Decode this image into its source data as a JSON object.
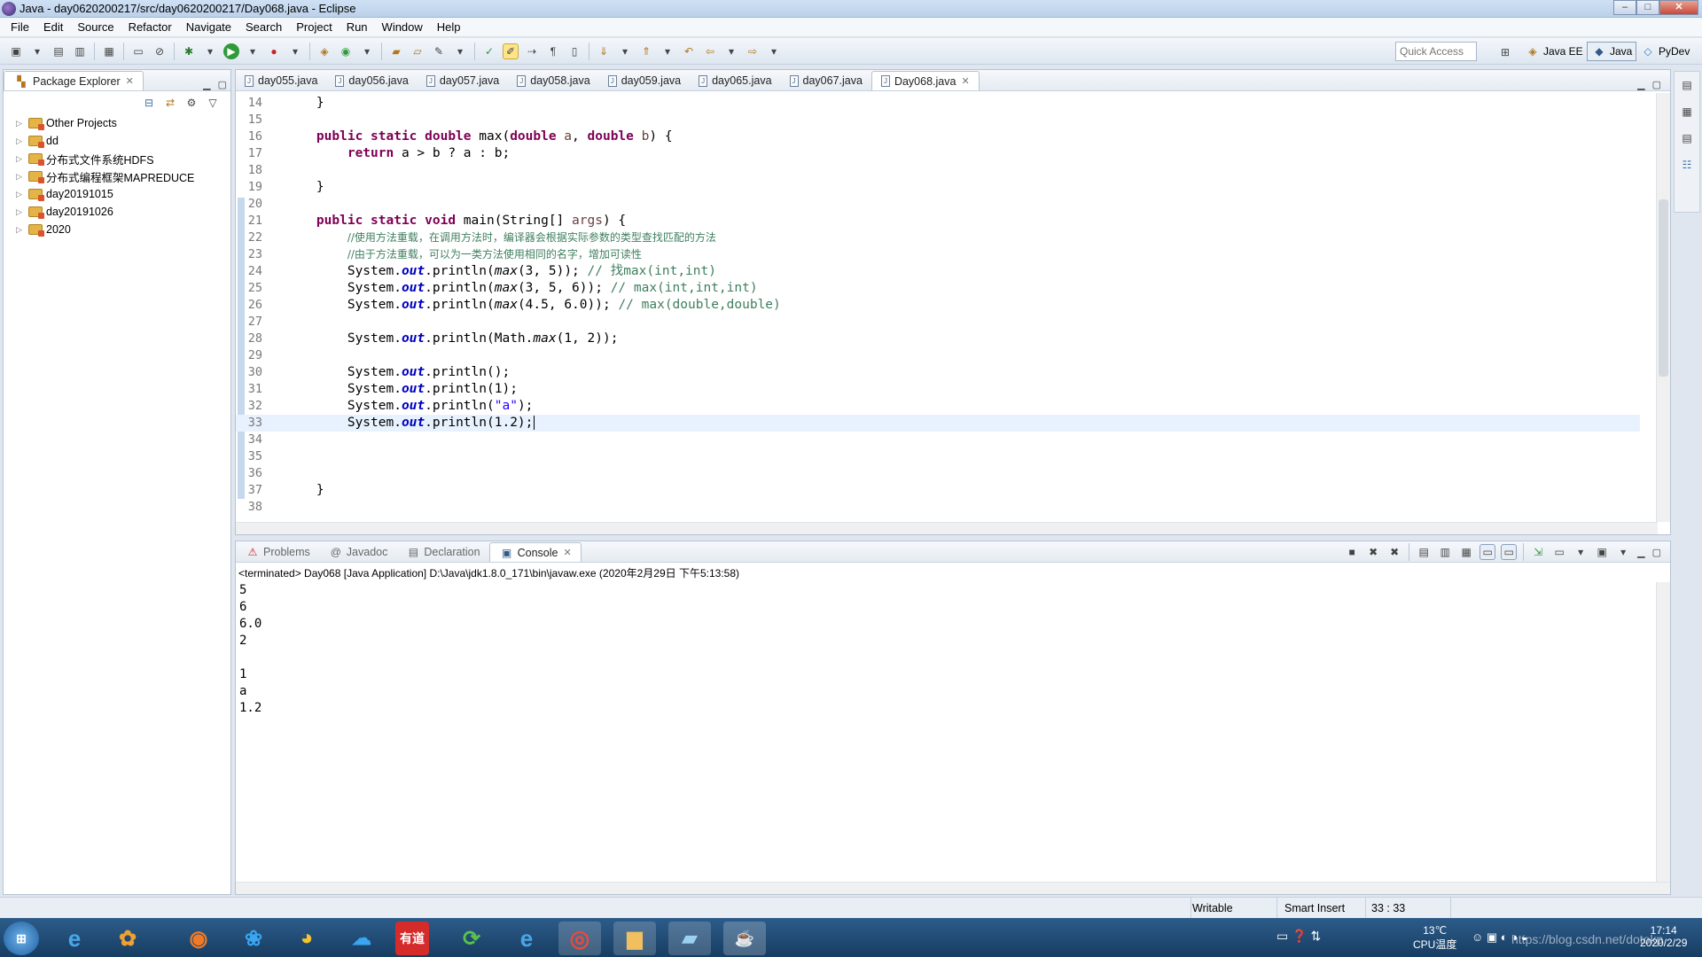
{
  "window": {
    "title": "Java - day0620200217/src/day0620200217/Day068.java - Eclipse"
  },
  "menu": [
    "File",
    "Edit",
    "Source",
    "Refactor",
    "Navigate",
    "Search",
    "Project",
    "Run",
    "Window",
    "Help"
  ],
  "toolbar": {
    "quick_access_placeholder": "Quick Access",
    "perspectives": [
      "Java EE",
      "Java",
      "PyDev"
    ]
  },
  "package_explorer": {
    "title": "Package Explorer",
    "items": [
      "Other Projects",
      "dd",
      "分布式文件系统HDFS",
      "分布式编程框架MAPREDUCE",
      "day20191015",
      "day20191026",
      "2020"
    ]
  },
  "editor": {
    "tabs": [
      "day055.java",
      "day056.java",
      "day057.java",
      "day058.java",
      "day059.java",
      "day065.java",
      "day067.java",
      "Day068.java"
    ],
    "active_tab": "Day068.java",
    "line_numbers": [
      "14",
      "15",
      "16",
      "17",
      "18",
      "19",
      "20",
      "21",
      "22",
      "23",
      "24",
      "25",
      "26",
      "27",
      "28",
      "29",
      "30",
      "31",
      "32",
      "33",
      "34",
      "35",
      "36",
      "37",
      "38"
    ],
    "code": {
      "l14_brace": "}",
      "l16_kw": "public static double",
      "l16_rest": " max(",
      "l16_type1": "double",
      "l16_param1": " a",
      "l16_comma": ", ",
      "l16_type2": "double",
      "l16_param2": " b",
      "l16_end": ") {",
      "l17_kw": "return",
      "l17_rest": " a > b ? a : b;",
      "l19_brace": "}",
      "l21_kw": "public static void",
      "l21_rest": " main(String[] ",
      "l21_param": "args",
      "l21_end": ") {",
      "l22_comment": "//使用方法重载，在调用方法时，编译器会根据实际参数的类型查找匹配的方法",
      "l23_comment": "//由于方法重载，可以为一类方法使用相同的名字，增加可读性",
      "sys": "System.",
      "out": "out",
      "println": ".println(",
      "l24_method": "max",
      "l24_args": "(3, 5)); ",
      "l24_comment": "// 找max(int,int)",
      "l25_method": "max",
      "l25_args": "(3, 5, 6)); ",
      "l25_comment": "// max(int,int,int)",
      "l26_method": "max",
      "l26_args": "(4.5, 6.0)); ",
      "l26_comment": "// max(double,double)",
      "l28_pre": "Math.",
      "l28_method": "max",
      "l28_args": "(1, 2));",
      "l30_end": ");",
      "l31_end": "1);",
      "l32_str": "\"a\"",
      "l32_end": ");",
      "l33_end": "1.2);",
      "l37_brace": "}"
    }
  },
  "bottom_panel": {
    "tabs": [
      "Problems",
      "Javadoc",
      "Declaration",
      "Console"
    ],
    "active_tab": "Console",
    "console_header": "<terminated> Day068 [Java Application] D:\\Java\\jdk1.8.0_171\\bin\\javaw.exe (2020年2月29日 下午5:13:58)",
    "output": [
      "5",
      "6",
      "6.0",
      "2",
      "",
      "1",
      "a",
      "1.2"
    ]
  },
  "status": {
    "writable": "Writable",
    "insert_mode": "Smart Insert",
    "position": "33 : 33"
  },
  "taskbar": {
    "temp": "13℃",
    "cpu_label": "CPU温度",
    "time": "17:14",
    "date": "2020/2/29",
    "watermark": "https://blog.csdn.net/dotokp"
  },
  "colors": {
    "keyword": "#7f0055",
    "comment": "#3f7f5f",
    "field": "#0000c0",
    "string": "#2a00ff",
    "current_line": "#e8f2fe"
  }
}
